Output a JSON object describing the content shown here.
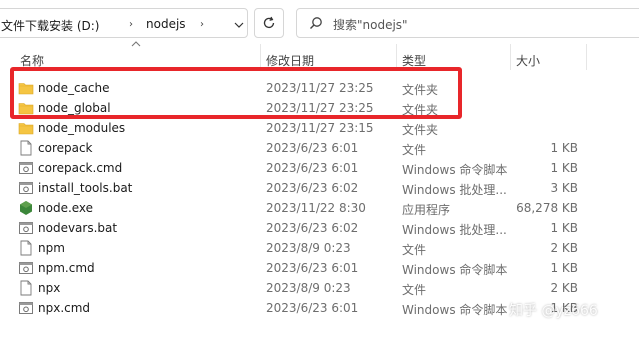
{
  "address_bar": {
    "crumbs": [
      "文件下载安装 (D:)",
      "nodejs"
    ],
    "separator": "›"
  },
  "search": {
    "placeholder": "搜索\"nodejs\""
  },
  "columns": {
    "name": "名称",
    "date": "修改日期",
    "type": "类型",
    "size": "大小"
  },
  "files": [
    {
      "name": "node_cache",
      "date": "2023/11/27 23:25",
      "type": "文件夹",
      "size": "",
      "icon": "folder-icon"
    },
    {
      "name": "node_global",
      "date": "2023/11/27 23:25",
      "type": "文件夹",
      "size": "",
      "icon": "folder-icon"
    },
    {
      "name": "node_modules",
      "date": "2023/11/27 23:15",
      "type": "文件夹",
      "size": "",
      "icon": "folder-icon"
    },
    {
      "name": "corepack",
      "date": "2023/6/23 6:01",
      "type": "文件",
      "size": "1 KB",
      "icon": "file-icon"
    },
    {
      "name": "corepack.cmd",
      "date": "2023/6/23 6:01",
      "type": "Windows 命令脚本",
      "size": "1 KB",
      "icon": "script-icon"
    },
    {
      "name": "install_tools.bat",
      "date": "2023/6/23 6:02",
      "type": "Windows 批处理...",
      "size": "3 KB",
      "icon": "script-icon"
    },
    {
      "name": "node.exe",
      "date": "2023/11/22 8:30",
      "type": "应用程序",
      "size": "68,278 KB",
      "icon": "node-exe-icon"
    },
    {
      "name": "nodevars.bat",
      "date": "2023/6/23 6:02",
      "type": "Windows 批处理...",
      "size": "1 KB",
      "icon": "script-icon"
    },
    {
      "name": "npm",
      "date": "2023/8/9 0:23",
      "type": "文件",
      "size": "2 KB",
      "icon": "file-icon"
    },
    {
      "name": "npm.cmd",
      "date": "2023/6/23 6:01",
      "type": "Windows 命令脚本",
      "size": "1 KB",
      "icon": "script-icon"
    },
    {
      "name": "npx",
      "date": "2023/8/9 0:23",
      "type": "文件",
      "size": "2 KB",
      "icon": "file-icon"
    },
    {
      "name": "npx.cmd",
      "date": "2023/6/23 6:01",
      "type": "Windows 命令脚本",
      "size": "1 KB",
      "icon": "script-icon"
    }
  ],
  "colors": {
    "folder": "#f5c542",
    "highlight_box": "#e8262a",
    "node_exe": "#3c873a"
  },
  "watermark": "知乎 @yz666"
}
